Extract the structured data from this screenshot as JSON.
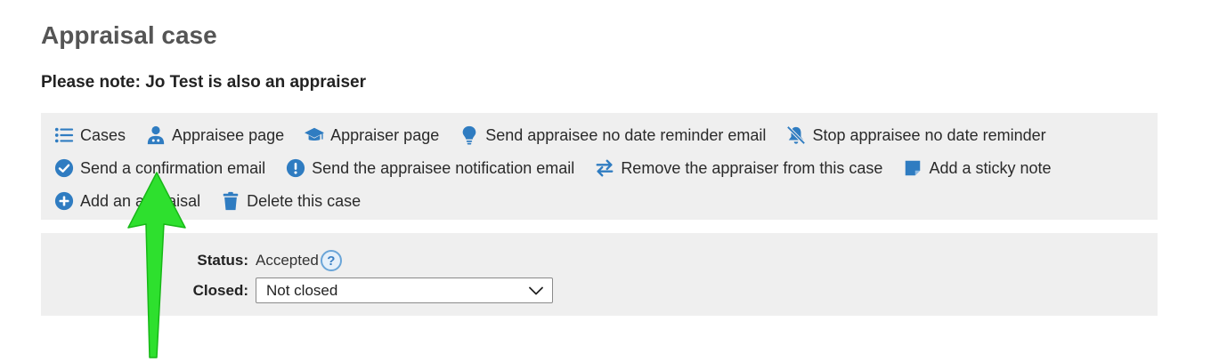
{
  "page_title": "Appraisal case",
  "note": "Please note: Jo Test is also an appraiser",
  "toolbar": {
    "cases": "Cases",
    "appraisee_page": "Appraisee page",
    "appraiser_page": "Appraiser page",
    "send_no_date_reminder": "Send appraisee no date reminder email",
    "stop_no_date_reminder": "Stop appraisee no date reminder",
    "send_confirmation": "Send a confirmation email",
    "send_notification": "Send the appraisee notification email",
    "remove_appraiser": "Remove the appraiser from this case",
    "add_sticky_note": "Add a sticky note",
    "add_appraisal": "Add an appraisal",
    "delete_case": "Delete this case"
  },
  "status": {
    "label": "Status:",
    "value": "Accepted",
    "help": "?"
  },
  "closed": {
    "label": "Closed:",
    "value": "Not closed"
  },
  "colors": {
    "accent": "#2f7cc1",
    "panel": "#efefef",
    "annotation_arrow": "#22dd22"
  }
}
